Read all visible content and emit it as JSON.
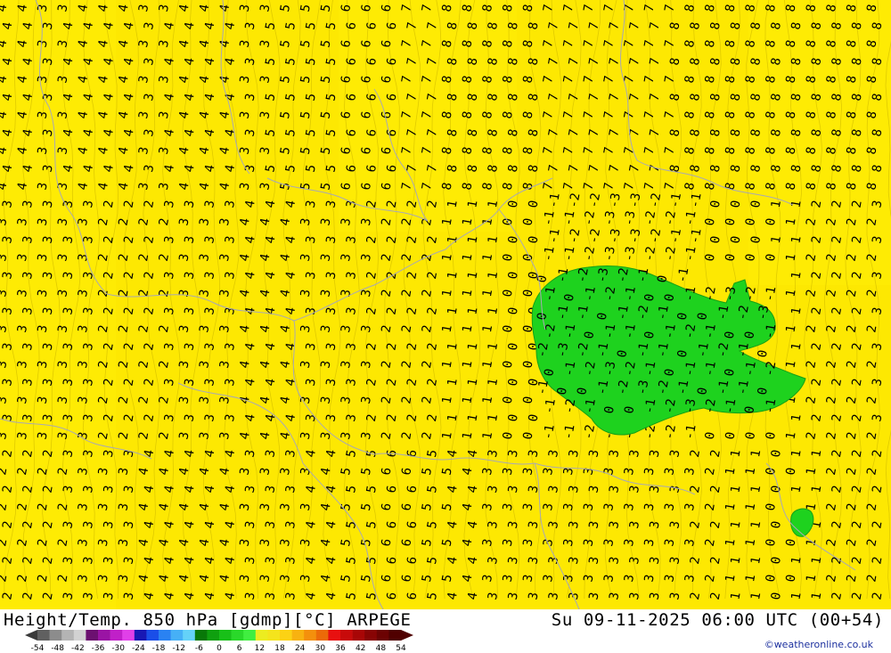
{
  "footer": {
    "title": "Height/Temp. 850 hPa [gdmp][°C] ARPEGE",
    "valid_time": "Su 09-11-2025 06:00 UTC (00+54)",
    "credit": "©weatheronline.co.uk"
  },
  "legend": {
    "ticks": [
      "-54",
      "-48",
      "-42",
      "-36",
      "-30",
      "-24",
      "-18",
      "-12",
      "-6",
      "0",
      "6",
      "12",
      "18",
      "24",
      "30",
      "36",
      "42",
      "48",
      "54"
    ],
    "colors": [
      "#606060",
      "#8c8c8c",
      "#b4b4b4",
      "#d2d2d2",
      "#6c1070",
      "#9a14a4",
      "#c020c8",
      "#e040e8",
      "#1818b4",
      "#1a4ee8",
      "#2a82f2",
      "#46b0f6",
      "#64d2f8",
      "#087808",
      "#0fa00f",
      "#18c018",
      "#2ad82a",
      "#40ee40",
      "#ecec20",
      "#f4e41c",
      "#fcd214",
      "#f8b210",
      "#f4900c",
      "#ec6a08",
      "#e81010",
      "#c80a0a",
      "#a80606",
      "#880404",
      "#6c0202",
      "#500000"
    ],
    "marker_color": "#3a3a3a"
  },
  "map": {
    "colors": {
      "warm": "#fde802",
      "warm_light": "#fff20a",
      "cold": "#1ed21e",
      "border": "#a9a9b4",
      "text": "#000000"
    },
    "contour_labels_row1": "4 3 4 4 3 4 4 3 5 5 6 6 7 8 8 8 7 7 7 7 8 8 8 8 8 8 8",
    "contour_labels_mid": "3 3 3 2 2 3 3 4 4 3 3 2 2 1 1 0 -1 -2 -3 -2 -1 0 0 1 2 2 3",
    "contour_labels_low": "2 2 3 3 4 4 4 3 3 4 5 6 5 4 3 3 3 3 3 3 2 1 0 1 2 2"
  }
}
